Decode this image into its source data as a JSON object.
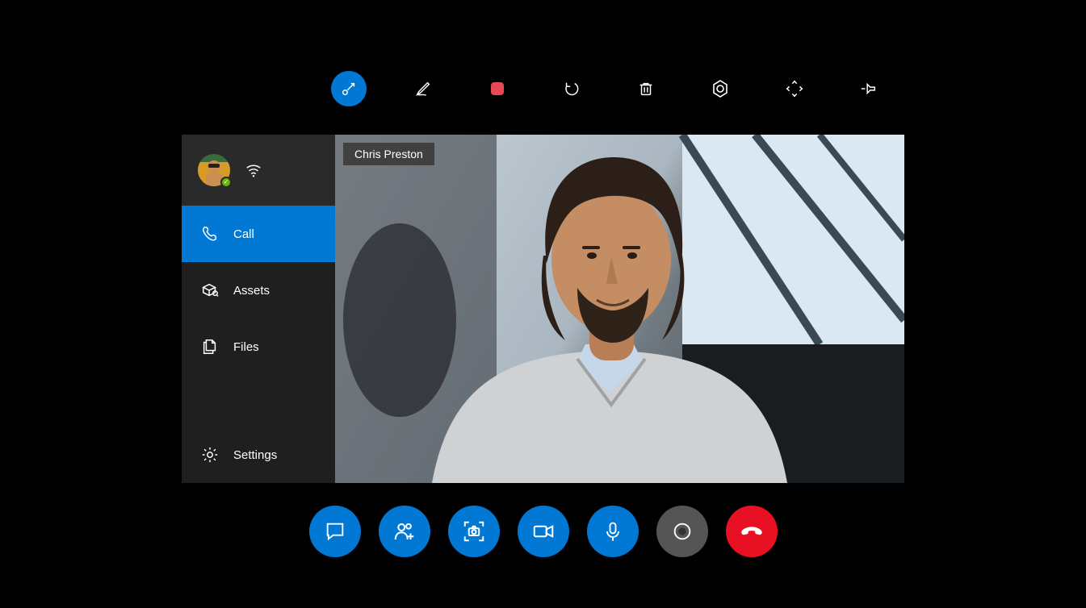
{
  "colors": {
    "accent": "#0078D4",
    "danger": "#E81123",
    "neutral": "#555555"
  },
  "top_toolbar": {
    "tools": [
      {
        "name": "laser-pointer-icon",
        "active": true
      },
      {
        "name": "pen-icon",
        "active": false
      },
      {
        "name": "stop-record-icon",
        "active": false
      },
      {
        "name": "undo-icon",
        "active": false
      },
      {
        "name": "delete-icon",
        "active": false
      },
      {
        "name": "settings-cog-icon",
        "active": false
      },
      {
        "name": "fit-screen-icon",
        "active": false
      },
      {
        "name": "pin-icon",
        "active": false
      }
    ]
  },
  "sidebar": {
    "network_icon": "wifi-icon",
    "items": [
      {
        "icon": "phone-icon",
        "label": "Call",
        "active": true
      },
      {
        "icon": "assets-icon",
        "label": "Assets",
        "active": false
      },
      {
        "icon": "files-icon",
        "label": "Files",
        "active": false
      }
    ],
    "footer": {
      "icon": "gear-icon",
      "label": "Settings"
    }
  },
  "video": {
    "participant_name": "Chris Preston"
  },
  "call_controls": [
    {
      "name": "chat-button",
      "style": "blue",
      "icon": "chat-icon"
    },
    {
      "name": "add-people-button",
      "style": "blue",
      "icon": "add-person-icon"
    },
    {
      "name": "snapshot-button",
      "style": "blue",
      "icon": "camera-frame-icon"
    },
    {
      "name": "video-button",
      "style": "blue",
      "icon": "video-icon"
    },
    {
      "name": "mic-button",
      "style": "blue",
      "icon": "mic-icon"
    },
    {
      "name": "record-button",
      "style": "grey",
      "icon": "record-icon"
    },
    {
      "name": "hangup-button",
      "style": "red",
      "icon": "hangup-icon"
    }
  ]
}
